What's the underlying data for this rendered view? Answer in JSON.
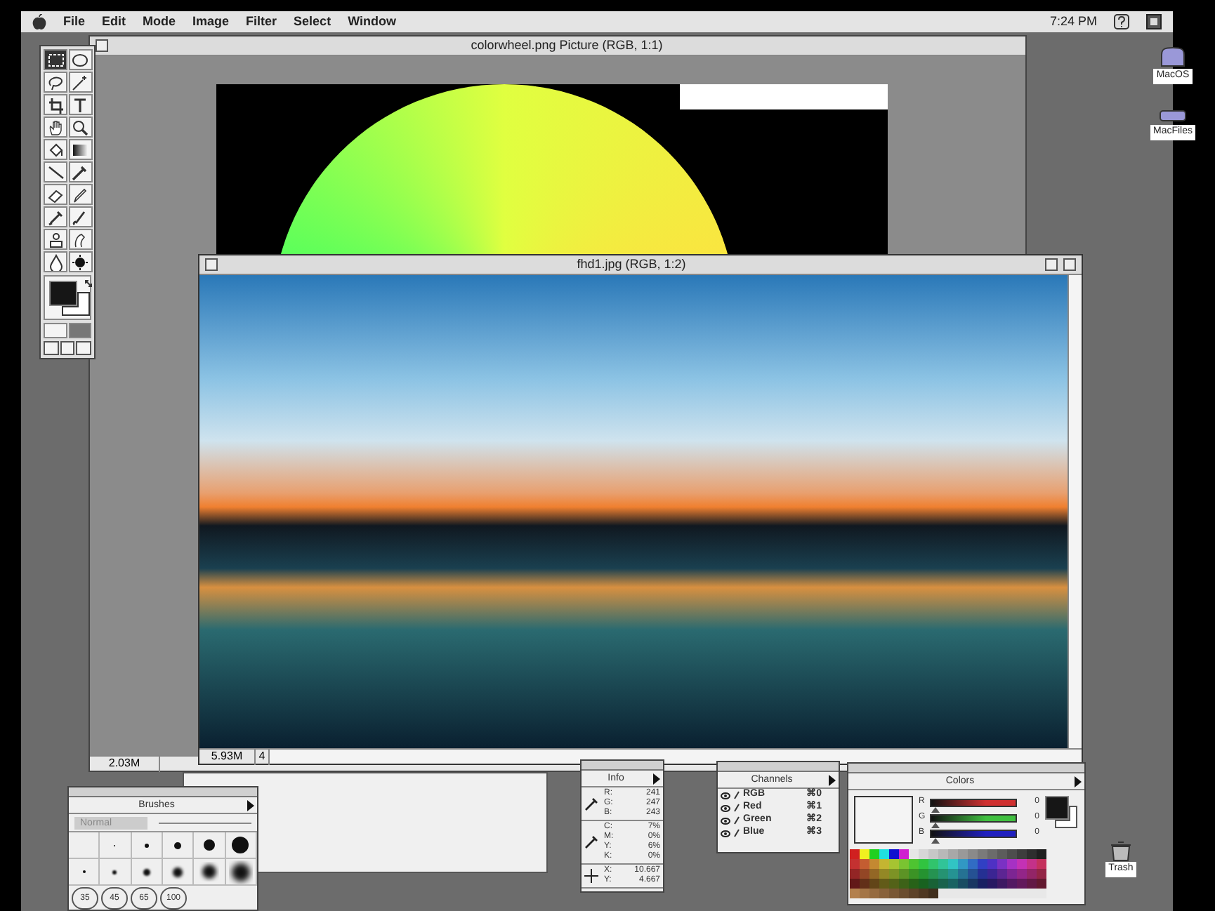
{
  "menu_bar": {
    "items": [
      "File",
      "Edit",
      "Mode",
      "Image",
      "Filter",
      "Select",
      "Window"
    ],
    "clock": "7:24 PM"
  },
  "tools": [
    {
      "kind": "marquee",
      "selected": true
    },
    {
      "kind": "ellipse",
      "selected": false
    },
    {
      "kind": "lasso",
      "selected": false
    },
    {
      "kind": "wand",
      "selected": false
    },
    {
      "kind": "crop",
      "selected": false
    },
    {
      "kind": "type",
      "selected": false
    },
    {
      "kind": "hand",
      "selected": false
    },
    {
      "kind": "zoom",
      "selected": false
    },
    {
      "kind": "bucket",
      "selected": false
    },
    {
      "kind": "gradient",
      "selected": false
    },
    {
      "kind": "line",
      "selected": false
    },
    {
      "kind": "eyedropper",
      "selected": false
    },
    {
      "kind": "eraser",
      "selected": false
    },
    {
      "kind": "pencil",
      "selected": false
    },
    {
      "kind": "airbrush",
      "selected": false
    },
    {
      "kind": "brush",
      "selected": false
    },
    {
      "kind": "stamp",
      "selected": false
    },
    {
      "kind": "smudge",
      "selected": false
    },
    {
      "kind": "blur",
      "selected": false
    },
    {
      "kind": "burn",
      "selected": false
    }
  ],
  "background_window": {
    "title": "colorwheel.png Picture  (RGB, 1:1)",
    "status": "2.03M"
  },
  "photo_window": {
    "title": "fhd1.jpg  (RGB, 1:2)",
    "status": "5.93M",
    "page": "4"
  },
  "desktop_icons": [
    {
      "label": "MacOS",
      "kind": "disk"
    },
    {
      "label": "MacFiles",
      "kind": "drive"
    },
    {
      "label": "Trash",
      "kind": "trash"
    }
  ],
  "brushes": {
    "title": "Brushes",
    "mode": "Normal",
    "sizes": [
      "35",
      "45",
      "65",
      "100"
    ]
  },
  "info": {
    "title": "Info",
    "groups": [
      {
        "kind": "dropper",
        "rows": [
          {
            "label": "R:",
            "value": "241"
          },
          {
            "label": "G:",
            "value": "247"
          },
          {
            "label": "B:",
            "value": "243"
          }
        ]
      },
      {
        "kind": "dropper",
        "rows": [
          {
            "label": "C:",
            "value": "7%"
          },
          {
            "label": "M:",
            "value": "0%"
          },
          {
            "label": "Y:",
            "value": "6%"
          },
          {
            "label": "K:",
            "value": "0%"
          }
        ]
      },
      {
        "kind": "cross",
        "rows": [
          {
            "label": "X:",
            "value": "10.667"
          },
          {
            "label": "Y:",
            "value": "4.667"
          }
        ]
      }
    ]
  },
  "channels": {
    "title": "Channels",
    "items": [
      {
        "name": "RGB",
        "shortcut": "⌘0",
        "visible": true
      },
      {
        "name": "Red",
        "shortcut": "⌘1",
        "visible": true
      },
      {
        "name": "Green",
        "shortcut": "⌘2",
        "visible": true
      },
      {
        "name": "Blue",
        "shortcut": "⌘3",
        "visible": true
      }
    ]
  },
  "colors": {
    "title": "Colors",
    "sliders": [
      {
        "label": "R",
        "value": "0",
        "level": 0,
        "color": "#d03030"
      },
      {
        "label": "G",
        "value": "0",
        "level": 0,
        "color": "#40c040"
      },
      {
        "label": "B",
        "value": "0",
        "level": 0,
        "color": "#2020c0"
      }
    ]
  }
}
